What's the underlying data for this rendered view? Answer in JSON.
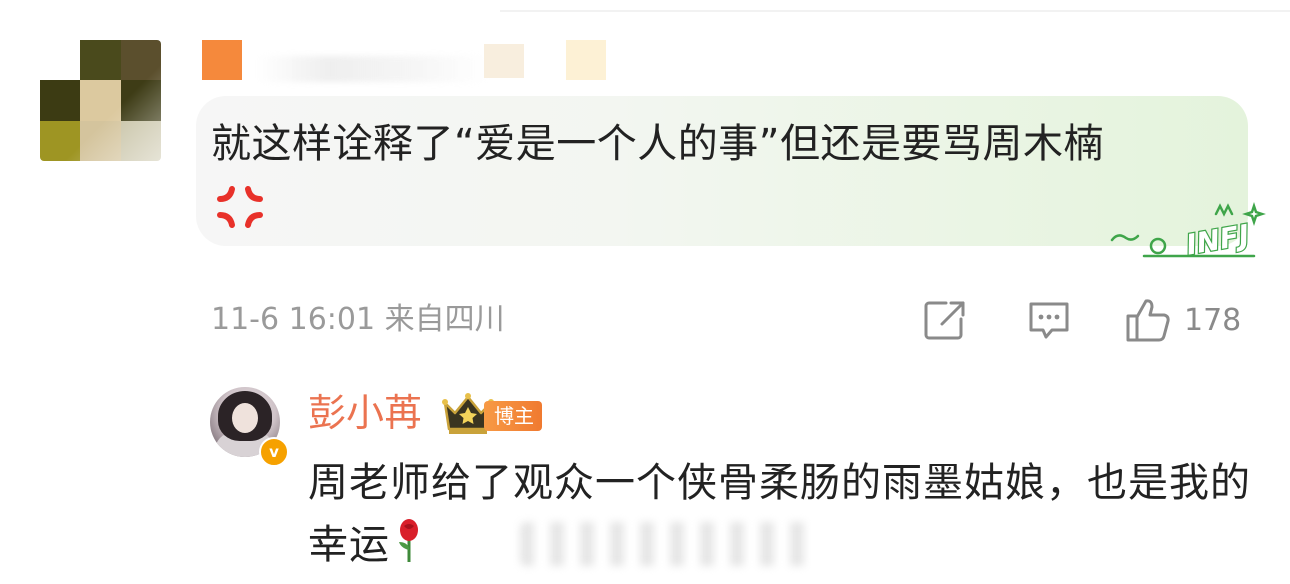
{
  "comment": {
    "author_avatar_mosaic": [
      "#ffffff",
      "#4a4a1c",
      "#5b4f2d",
      "#3c3b13",
      "#dcc99f",
      "#3e3c16",
      "#9e9523",
      "#d4c49d",
      "#c8c3a6"
    ],
    "author_name_mosaic": [
      "#f5893c",
      "#ffffff",
      "#f8eede",
      "#fdf1d5"
    ],
    "text": "就这样诠释了“爱是一个人的事”但还是要骂周木楠",
    "sticker_label": "INFJ",
    "timestamp": "11-6 16:01",
    "location": "来自四川",
    "meta": "11-6 16:01  来自四川",
    "like_count": "178",
    "colors": {
      "bubble_start": "#f6f6f6",
      "bubble_end": "#e4f3dc",
      "anger_red": "#e8312a",
      "sticker_green": "#3fa54a",
      "meta_gray": "#9a9a9a"
    }
  },
  "actions": {
    "share_icon": "share-icon",
    "reply_icon": "comment-icon",
    "like_icon": "thumbs-up-icon"
  },
  "reply": {
    "author": "彭小苒",
    "verified_mark": "v",
    "rank_icon": "crown-icon",
    "badge": "博主",
    "text": "周老师给了观众一个侠骨柔肠的雨墨姑娘，也是我的幸运",
    "trailing_emoji": "rose-icon",
    "colors": {
      "author": "#eb7350",
      "badge_bg": "#f07a30",
      "verified_bg": "#f6a100"
    }
  }
}
